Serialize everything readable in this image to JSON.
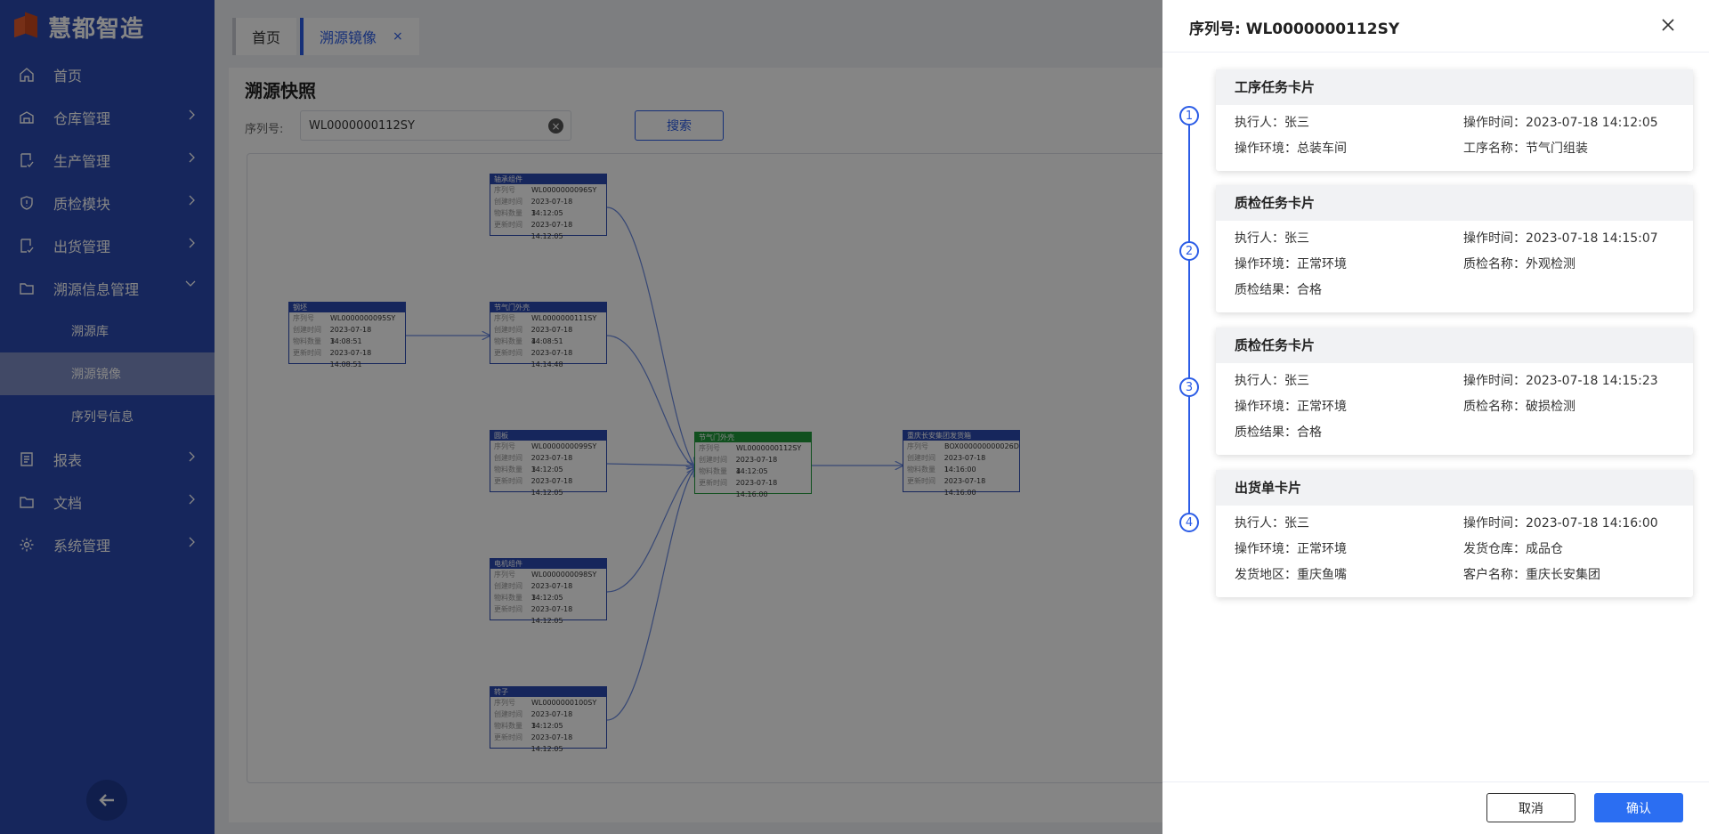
{
  "sidebar": {
    "brand": "慧都智造",
    "items": [
      {
        "label": "首页",
        "icon": "home-icon"
      },
      {
        "label": "仓库管理",
        "icon": "warehouse-icon"
      },
      {
        "label": "生产管理",
        "icon": "production-icon"
      },
      {
        "label": "质检模块",
        "icon": "shield-icon"
      },
      {
        "label": "出货管理",
        "icon": "shipping-icon"
      },
      {
        "label": "溯源信息管理",
        "icon": "folder-icon"
      },
      {
        "label": "报表",
        "icon": "report-icon"
      },
      {
        "label": "文档",
        "icon": "folder-icon"
      },
      {
        "label": "系统管理",
        "icon": "gear-icon"
      }
    ],
    "sub_items": [
      {
        "label": "溯源库"
      },
      {
        "label": "溯源镜像"
      },
      {
        "label": "序列号信息"
      }
    ]
  },
  "tabs": [
    {
      "label": "首页"
    },
    {
      "label": "溯源镜像",
      "close": "×"
    }
  ],
  "main": {
    "title": "溯源快照",
    "serial_label": "序列号:",
    "serial_value": "WL0000000112SY",
    "search_label": "搜索"
  },
  "graph": {
    "field_labels": [
      "序列号",
      "创建时间",
      "物料数量",
      "更新时间"
    ],
    "nodes": [
      {
        "title": "轴承组件",
        "serial": "WL0000000096SY",
        "created": "2023-07-18 14:12:05",
        "qty": "3",
        "updated": "2023-07-18 14:12:05"
      },
      {
        "title": "钢坯",
        "serial": "WL0000000095SY",
        "created": "2023-07-18 14:08:51",
        "qty": "3",
        "updated": "2023-07-18 14:08:51"
      },
      {
        "title": "节气门外壳",
        "serial": "WL0000000111SY",
        "created": "2023-07-18 14:08:51",
        "qty": "4",
        "updated": "2023-07-18 14:14:48"
      },
      {
        "title": "圆板",
        "serial": "WL0000000099SY",
        "created": "2023-07-18 14:12:05",
        "qty": "3",
        "updated": "2023-07-18 14:12:05"
      },
      {
        "title": "电机组件",
        "serial": "WL0000000098SY",
        "created": "2023-07-18 14:12:05",
        "qty": "3",
        "updated": "2023-07-18 14:12:05"
      },
      {
        "title": "转子",
        "serial": "WL0000000100SY",
        "created": "2023-07-18 14:12:05",
        "qty": "3",
        "updated": "2023-07-18 14:12:05"
      },
      {
        "title": "节气门外壳",
        "serial": "WL0000000112SY",
        "created": "2023-07-18 14:12:05",
        "qty": "4",
        "updated": "2023-07-18 14:16:00"
      },
      {
        "title": "重庆长安集团发货箱",
        "serial": "BOX000000000026D",
        "created": "2023-07-18 14:16:00",
        "qty": "1",
        "updated": "2023-07-18 14:16:00"
      }
    ]
  },
  "drawer": {
    "title": "序列号:  WL0000000112SY",
    "cancel_label": "取消",
    "confirm_label": "确认",
    "cards": [
      {
        "step": "1",
        "title": "工序任务卡片",
        "fields": [
          "执行人：张三",
          "操作时间：2023-07-18 14:12:05",
          "操作环境：总装车间",
          "工序名称：节气门组装"
        ]
      },
      {
        "step": "2",
        "title": "质检任务卡片",
        "fields": [
          "执行人：张三",
          "操作时间：2023-07-18 14:15:07",
          "操作环境：正常环境",
          "质检名称：外观检测",
          "质检结果：合格",
          ""
        ]
      },
      {
        "step": "3",
        "title": "质检任务卡片",
        "fields": [
          "执行人：张三",
          "操作时间：2023-07-18 14:15:23",
          "操作环境：正常环境",
          "质检名称：破损检测",
          "质检结果：合格",
          ""
        ]
      },
      {
        "step": "4",
        "title": "出货单卡片",
        "fields": [
          "执行人：张三",
          "操作时间：2023-07-18 14:16:00",
          "操作环境：正常环境",
          "发货仓库：成品仓",
          "发货地区：重庆鱼嘴",
          "客户名称：重庆长安集团"
        ]
      }
    ]
  },
  "colors": {
    "sidebar": "#2b49b0",
    "accent": "#2b5ce6",
    "node_blue": "#2b49b0",
    "node_green": "#1f9a3a"
  }
}
